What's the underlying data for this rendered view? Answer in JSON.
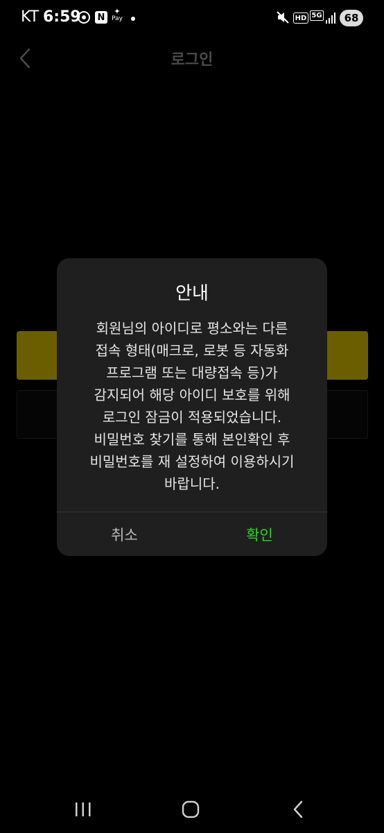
{
  "status_bar": {
    "carrier": "KT",
    "time": "6:59",
    "notification_n_label": "N",
    "pay_label": "Pay",
    "battery": "68",
    "hd_label": "HD",
    "network_label": "5G",
    "icons": [
      "settings-gear-icon",
      "naver-icon",
      "samsung-pay-icon",
      "notification-dot-icon",
      "mute-icon",
      "hd-voice-icon",
      "5g-icon",
      "signal-icon",
      "battery-icon"
    ]
  },
  "header": {
    "title": "로그인",
    "back_icon": "chevron-left-icon"
  },
  "dialog": {
    "title": "안내",
    "message": "회원님의 아이디로 평소와는 다른\n접속 형태(매크로, 로봇 등 자동화\n프로그램 또는 대량접속 등)가\n감지되어 해당 아이디 보호를 위해\n로그인 잠금이 적용되었습니다.\n비밀번호 찾기를 통해 본인확인 후\n비밀번호를 재 설정하여 이용하시기\n바랍니다.",
    "cancel_label": "취소",
    "confirm_label": "확인"
  },
  "nav_bar": {
    "icons": [
      "recent-apps-icon",
      "home-icon",
      "back-icon"
    ]
  },
  "colors": {
    "background": "#000000",
    "dialog_bg": "#1f1f1f",
    "confirm": "#2bd12b",
    "dim_yellow": "#6b5e00"
  }
}
